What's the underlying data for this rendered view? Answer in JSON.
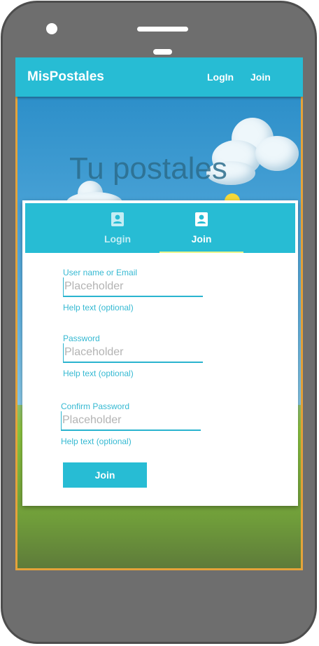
{
  "appbar": {
    "title": "MisPostales",
    "login_link": "LogIn",
    "join_link": "Join"
  },
  "hero": {
    "title": "Tu postales"
  },
  "tabs": [
    {
      "label": "Login",
      "icon": "account-box-icon",
      "active": false
    },
    {
      "label": "Join",
      "icon": "account-box-icon",
      "active": true
    }
  ],
  "form": {
    "username": {
      "label": "User name or Email",
      "value": "",
      "placeholder": "Placeholder",
      "help": "Help text (optional)"
    },
    "password": {
      "label": "Password",
      "value": "",
      "placeholder": "Placeholder",
      "help": "Help text (optional)"
    },
    "confirm_password": {
      "label": "Confirm Password",
      "value": "",
      "placeholder": "Placeholder",
      "help": "Help text (optional)"
    },
    "submit_label": "Join"
  },
  "colors": {
    "primary": "#27bcd4",
    "accent_indicator": "#e9f58c",
    "frame_border": "#e5a33a",
    "phone_body": "#6e6e6e"
  }
}
